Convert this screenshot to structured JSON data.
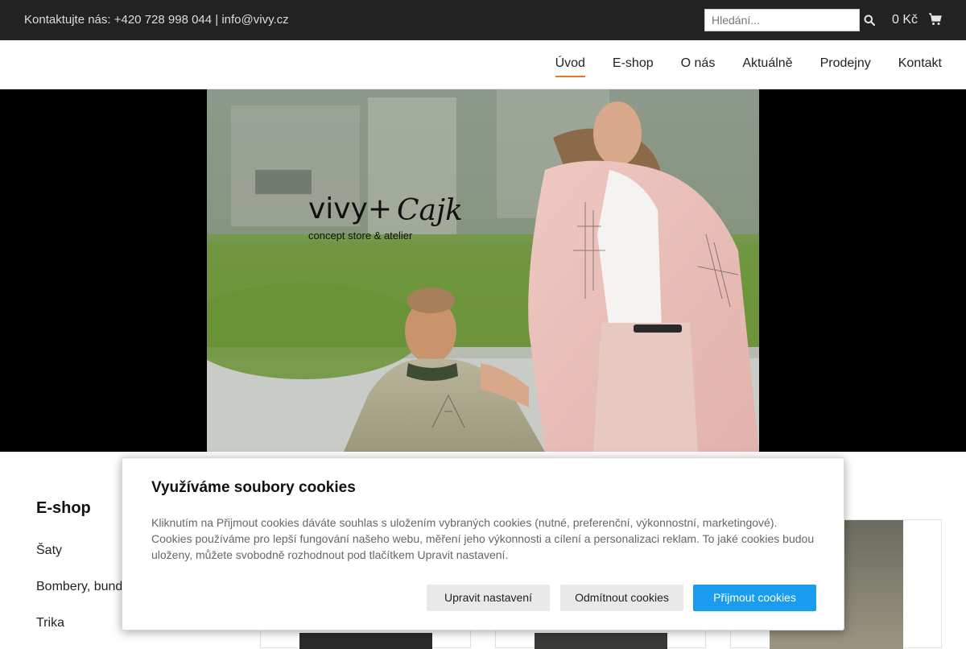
{
  "topbar": {
    "contact": "Kontaktujte nás: +420 728 998 044 | info@vivy.cz",
    "search_placeholder": "Hledání...",
    "cart_total": "0 Kč"
  },
  "nav": {
    "items": [
      "Úvod",
      "E-shop",
      "O nás",
      "Aktuálně",
      "Prodejny",
      "Kontakt"
    ],
    "active": "Úvod"
  },
  "hero": {
    "logo_main": "vivy+",
    "logo_script": "Cajk",
    "logo_sub": "concept store & atelier"
  },
  "sidebar": {
    "title": "E-shop",
    "items": [
      "Šaty",
      "Bombery, bundy",
      "Trika"
    ]
  },
  "cookie": {
    "title": "Využíváme soubory cookies",
    "text": "Kliknutím na Přijmout cookies dáváte souhlas s uložením vybraných cookies (nutné, preferenční, výkonnostní, marketingové). Cookies používáme pro lepší fungování našeho webu, měření jeho výkonnosti a cílení a personalizaci reklam. To jaké cookies budou uloženy, můžete svobodně rozhodnout pod tlačítkem Upravit nastavení.",
    "btn_settings": "Upravit nastavení",
    "btn_reject": "Odmítnout cookies",
    "btn_accept": "Přijmout cookies"
  },
  "colors": {
    "topbar_bg": "#222222",
    "nav_active_underline": "#e2782e",
    "accept_button": "#1a9cf0"
  }
}
